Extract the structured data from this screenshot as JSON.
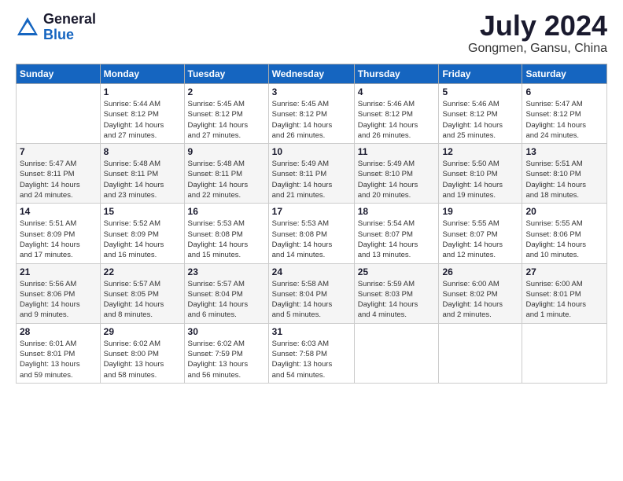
{
  "logo": {
    "general": "General",
    "blue": "Blue"
  },
  "title": "July 2024",
  "location": "Gongmen, Gansu, China",
  "headers": [
    "Sunday",
    "Monday",
    "Tuesday",
    "Wednesday",
    "Thursday",
    "Friday",
    "Saturday"
  ],
  "weeks": [
    [
      {
        "day": "",
        "info": ""
      },
      {
        "day": "1",
        "info": "Sunrise: 5:44 AM\nSunset: 8:12 PM\nDaylight: 14 hours\nand 27 minutes."
      },
      {
        "day": "2",
        "info": "Sunrise: 5:45 AM\nSunset: 8:12 PM\nDaylight: 14 hours\nand 27 minutes."
      },
      {
        "day": "3",
        "info": "Sunrise: 5:45 AM\nSunset: 8:12 PM\nDaylight: 14 hours\nand 26 minutes."
      },
      {
        "day": "4",
        "info": "Sunrise: 5:46 AM\nSunset: 8:12 PM\nDaylight: 14 hours\nand 26 minutes."
      },
      {
        "day": "5",
        "info": "Sunrise: 5:46 AM\nSunset: 8:12 PM\nDaylight: 14 hours\nand 25 minutes."
      },
      {
        "day": "6",
        "info": "Sunrise: 5:47 AM\nSunset: 8:12 PM\nDaylight: 14 hours\nand 24 minutes."
      }
    ],
    [
      {
        "day": "7",
        "info": "Sunrise: 5:47 AM\nSunset: 8:11 PM\nDaylight: 14 hours\nand 24 minutes."
      },
      {
        "day": "8",
        "info": "Sunrise: 5:48 AM\nSunset: 8:11 PM\nDaylight: 14 hours\nand 23 minutes."
      },
      {
        "day": "9",
        "info": "Sunrise: 5:48 AM\nSunset: 8:11 PM\nDaylight: 14 hours\nand 22 minutes."
      },
      {
        "day": "10",
        "info": "Sunrise: 5:49 AM\nSunset: 8:11 PM\nDaylight: 14 hours\nand 21 minutes."
      },
      {
        "day": "11",
        "info": "Sunrise: 5:49 AM\nSunset: 8:10 PM\nDaylight: 14 hours\nand 20 minutes."
      },
      {
        "day": "12",
        "info": "Sunrise: 5:50 AM\nSunset: 8:10 PM\nDaylight: 14 hours\nand 19 minutes."
      },
      {
        "day": "13",
        "info": "Sunrise: 5:51 AM\nSunset: 8:10 PM\nDaylight: 14 hours\nand 18 minutes."
      }
    ],
    [
      {
        "day": "14",
        "info": "Sunrise: 5:51 AM\nSunset: 8:09 PM\nDaylight: 14 hours\nand 17 minutes."
      },
      {
        "day": "15",
        "info": "Sunrise: 5:52 AM\nSunset: 8:09 PM\nDaylight: 14 hours\nand 16 minutes."
      },
      {
        "day": "16",
        "info": "Sunrise: 5:53 AM\nSunset: 8:08 PM\nDaylight: 14 hours\nand 15 minutes."
      },
      {
        "day": "17",
        "info": "Sunrise: 5:53 AM\nSunset: 8:08 PM\nDaylight: 14 hours\nand 14 minutes."
      },
      {
        "day": "18",
        "info": "Sunrise: 5:54 AM\nSunset: 8:07 PM\nDaylight: 14 hours\nand 13 minutes."
      },
      {
        "day": "19",
        "info": "Sunrise: 5:55 AM\nSunset: 8:07 PM\nDaylight: 14 hours\nand 12 minutes."
      },
      {
        "day": "20",
        "info": "Sunrise: 5:55 AM\nSunset: 8:06 PM\nDaylight: 14 hours\nand 10 minutes."
      }
    ],
    [
      {
        "day": "21",
        "info": "Sunrise: 5:56 AM\nSunset: 8:06 PM\nDaylight: 14 hours\nand 9 minutes."
      },
      {
        "day": "22",
        "info": "Sunrise: 5:57 AM\nSunset: 8:05 PM\nDaylight: 14 hours\nand 8 minutes."
      },
      {
        "day": "23",
        "info": "Sunrise: 5:57 AM\nSunset: 8:04 PM\nDaylight: 14 hours\nand 6 minutes."
      },
      {
        "day": "24",
        "info": "Sunrise: 5:58 AM\nSunset: 8:04 PM\nDaylight: 14 hours\nand 5 minutes."
      },
      {
        "day": "25",
        "info": "Sunrise: 5:59 AM\nSunset: 8:03 PM\nDaylight: 14 hours\nand 4 minutes."
      },
      {
        "day": "26",
        "info": "Sunrise: 6:00 AM\nSunset: 8:02 PM\nDaylight: 14 hours\nand 2 minutes."
      },
      {
        "day": "27",
        "info": "Sunrise: 6:00 AM\nSunset: 8:01 PM\nDaylight: 14 hours\nand 1 minute."
      }
    ],
    [
      {
        "day": "28",
        "info": "Sunrise: 6:01 AM\nSunset: 8:01 PM\nDaylight: 13 hours\nand 59 minutes."
      },
      {
        "day": "29",
        "info": "Sunrise: 6:02 AM\nSunset: 8:00 PM\nDaylight: 13 hours\nand 58 minutes."
      },
      {
        "day": "30",
        "info": "Sunrise: 6:02 AM\nSunset: 7:59 PM\nDaylight: 13 hours\nand 56 minutes."
      },
      {
        "day": "31",
        "info": "Sunrise: 6:03 AM\nSunset: 7:58 PM\nDaylight: 13 hours\nand 54 minutes."
      },
      {
        "day": "",
        "info": ""
      },
      {
        "day": "",
        "info": ""
      },
      {
        "day": "",
        "info": ""
      }
    ]
  ]
}
